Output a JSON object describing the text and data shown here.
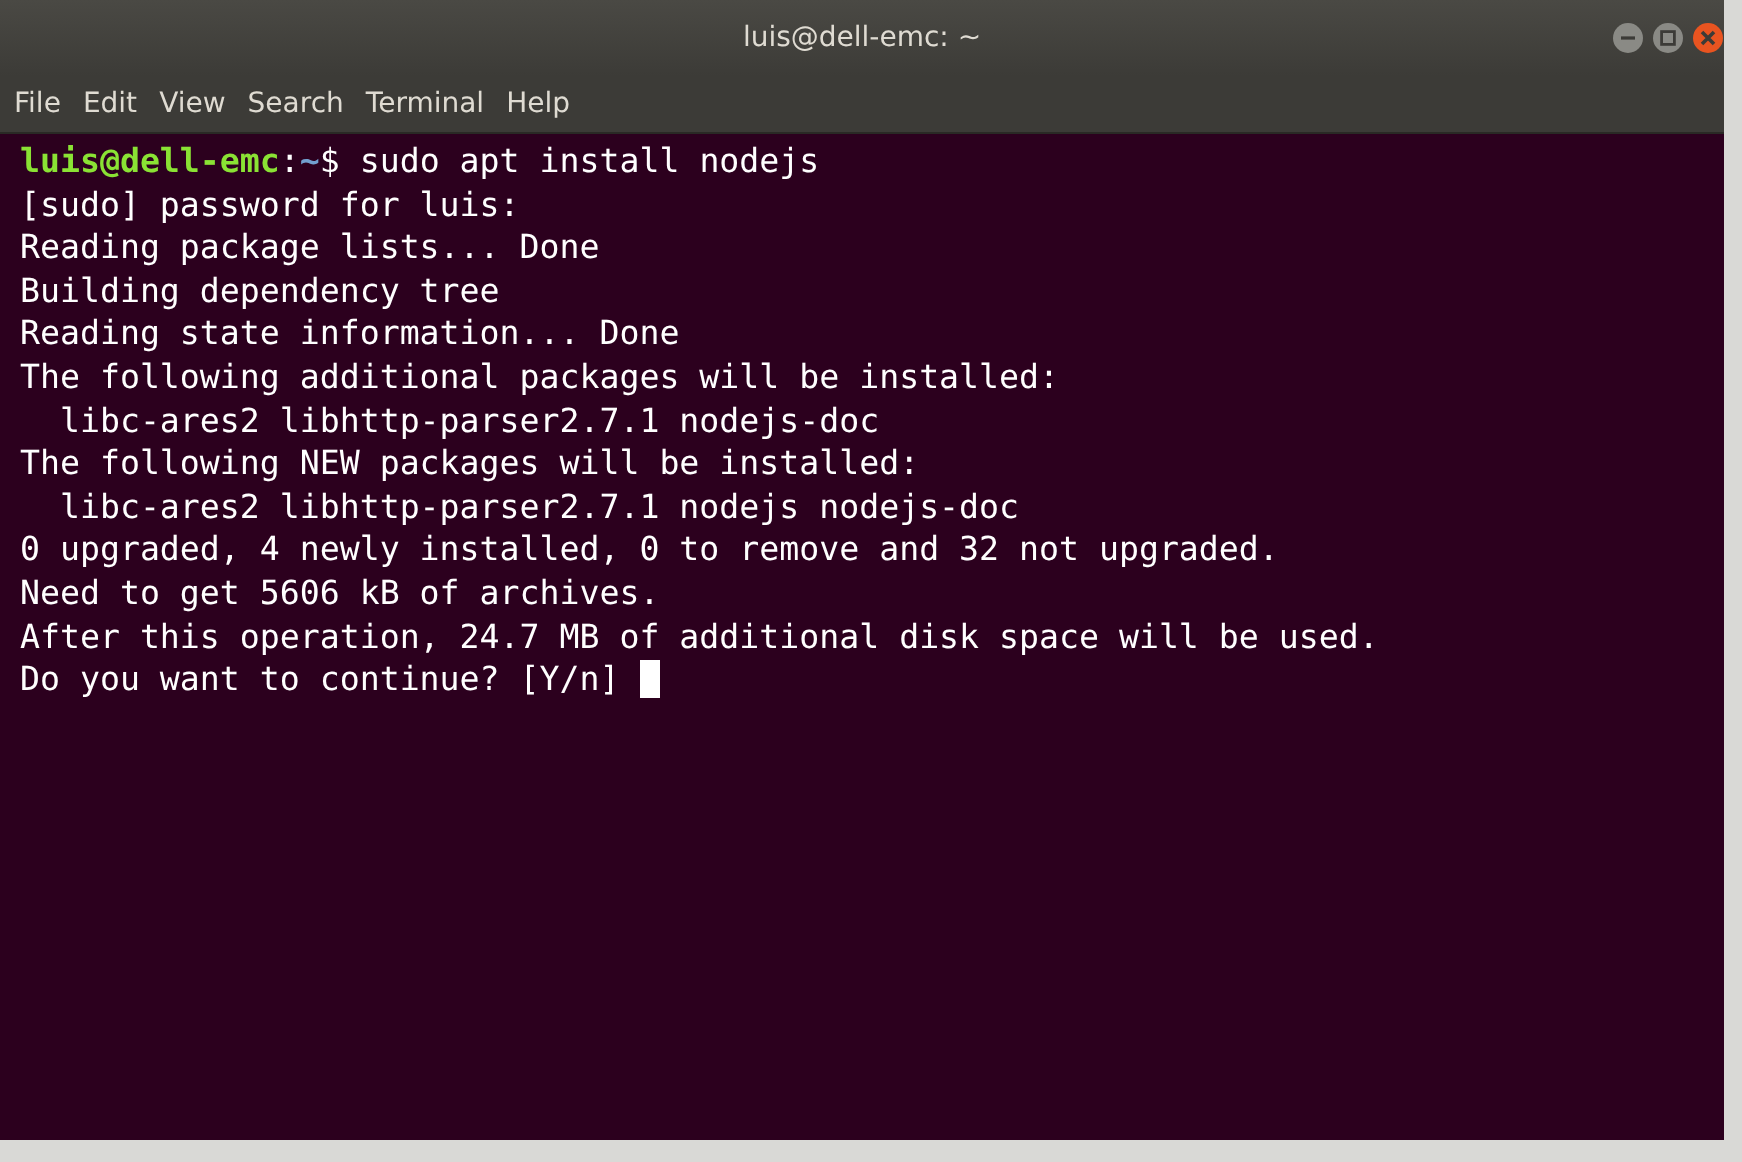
{
  "window": {
    "title": "luis@dell-emc: ~"
  },
  "menu": [
    "File",
    "Edit",
    "View",
    "Search",
    "Terminal",
    "Help"
  ],
  "terminal": {
    "prompt": {
      "user_host": "luis@dell-emc",
      "separator": ":",
      "path": "~",
      "symbol": "$",
      "command": "sudo apt install nodejs"
    },
    "output": [
      "[sudo] password for luis:",
      "Reading package lists... Done",
      "Building dependency tree",
      "Reading state information... Done",
      "The following additional packages will be installed:",
      "  libc-ares2 libhttp-parser2.7.1 nodejs-doc",
      "The following NEW packages will be installed:",
      "  libc-ares2 libhttp-parser2.7.1 nodejs nodejs-doc",
      "0 upgraded, 4 newly installed, 0 to remove and 32 not upgraded.",
      "Need to get 5606 kB of archives.",
      "After this operation, 24.7 MB of additional disk space will be used.",
      "Do you want to continue? [Y/n]"
    ]
  }
}
